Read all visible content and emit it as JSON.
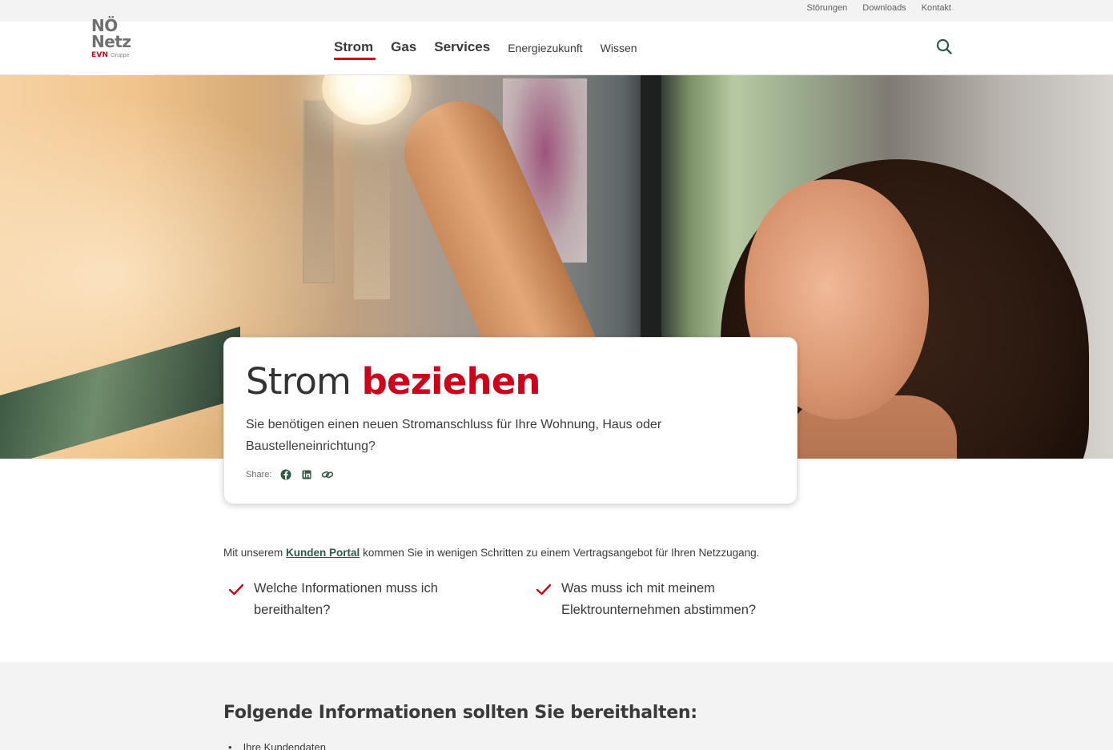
{
  "utility_nav": {
    "items": [
      "Störungen",
      "Downloads",
      "Kontakt"
    ]
  },
  "logo": {
    "line1": "NÖ",
    "line2": "Netz",
    "brand": "EVN",
    "group": "Gruppe"
  },
  "main_nav": {
    "items": [
      "Strom",
      "Gas",
      "Services",
      "Energiezukunft",
      "Wissen"
    ],
    "active": "Strom"
  },
  "icons": {
    "search": "search-icon",
    "share": [
      "facebook-icon",
      "linkedin-icon",
      "link-icon"
    ],
    "check": "checkmark-icon"
  },
  "hero": {
    "title_plain": "Strom",
    "title_accent": "beziehen",
    "description": "Sie benötigen einen neuen Stromanschluss für Ihre Wohnung, Haus oder Baustelleneinrichtung?",
    "share_label": "Share:"
  },
  "intro": {
    "prefix": "Mit unserem",
    "link": "Kunden Portal",
    "suffix": "kommen Sie in wenigen Schritten zu einem Vertragsangebot für Ihren Netzzugang."
  },
  "checklist": [
    "Welche Informationen muss ich bereithalten?",
    "Was muss ich mit meinem Elektrounternehmen abstimmen?"
  ],
  "info_section": {
    "title": "Folgende Informationen sollten Sie bereithalten:",
    "items": [
      "Ihre Kundendaten"
    ]
  },
  "colors": {
    "accent_red": "#d0021b",
    "link_green": "#2f5b45",
    "text": "#3c3c3c",
    "grey_bg": "#f3f3f3"
  }
}
